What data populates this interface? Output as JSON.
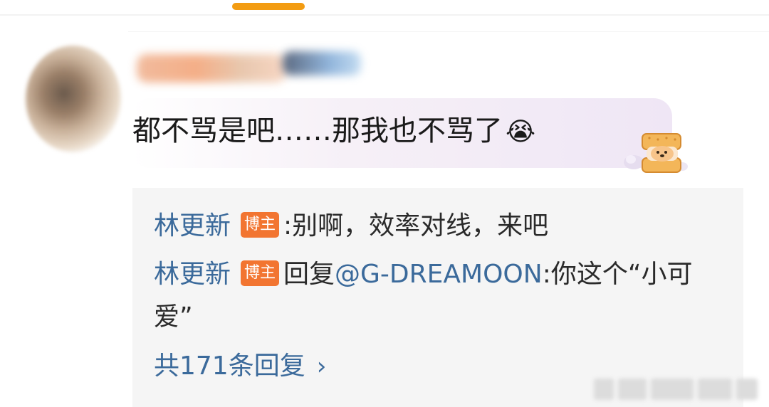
{
  "comment": {
    "text": "都不骂是吧……那我也不骂了",
    "emoji": "😭"
  },
  "replies": [
    {
      "author": "林更新",
      "badge": "博主",
      "separator": ":",
      "text": "别啊，效率对线，来吧"
    },
    {
      "author": "林更新",
      "badge": "博主",
      "prefix": "回复",
      "mention": "@G-DREAMOON",
      "text": ":你这个“小可",
      "text_cont": "爱”"
    }
  ],
  "more_replies": {
    "label": "共171条回复",
    "icon": "chevron-right-icon"
  },
  "colors": {
    "accent": "#f39c12",
    "link": "#3b6a9b",
    "badge": "#f27531"
  }
}
